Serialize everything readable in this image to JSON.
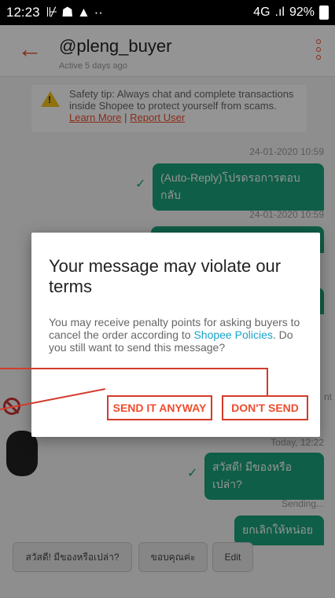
{
  "status_bar": {
    "time": "12:23",
    "left_icons": "⊮ ☗ ▲ ··",
    "network": "4G",
    "battery": "92%"
  },
  "header": {
    "username": "@pleng_buyer",
    "active_status": "Active 5 days ago"
  },
  "chat": {
    "safety_tip_text": "Safety tip: Always chat and complete transactions inside Shopee to protect yourself from scams.",
    "learn_more": "Learn More",
    "report_user": "Report User",
    "messages": [
      {
        "timestamp": "24-01-2020 10:59",
        "text": "(Auto-Reply)โปรดรอการตอบกลับ",
        "status": "✓"
      },
      {
        "timestamp": "24-01-2020 10:59",
        "text": "",
        "status": ""
      },
      {
        "timestamp": "Today, 12:22",
        "text": "สวัสดี! มีของหรือเปล่า?",
        "status": "✓"
      },
      {
        "timestamp": "Sending...",
        "text": "ยกเลิกให้หน่อย",
        "status": ""
      }
    ],
    "right_fragment": "nt"
  },
  "quick_replies": [
    "สวัสดี! มีของหรือเปล่า?",
    "ขอบคุณค่ะ",
    "Edit"
  ],
  "dialog": {
    "title": "Your message may violate our terms",
    "body_prefix": "You may receive penalty points for asking buyers to cancel the order according to ",
    "body_link": "Shopee Policies",
    "body_suffix": ". Do you still want to send this message?",
    "send_anyway": "SEND IT ANYWAY",
    "dont_send": "DON'T SEND"
  },
  "colors": {
    "brand": "#ee4d2d",
    "bubble": "#1aa37a",
    "annotation": "#d23b2c"
  }
}
